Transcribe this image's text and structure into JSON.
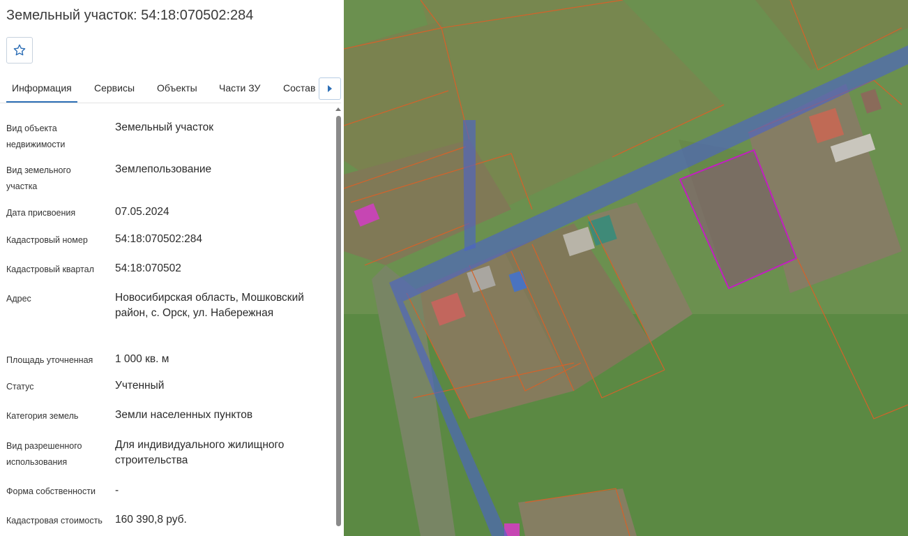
{
  "header": {
    "title": "Земельный участок: 54:18:070502:284"
  },
  "toolbar": {
    "favorite_icon": "star-icon"
  },
  "tabs": [
    {
      "label": "Информация",
      "active": true
    },
    {
      "label": "Сервисы",
      "active": false
    },
    {
      "label": "Объекты",
      "active": false
    },
    {
      "label": "Части ЗУ",
      "active": false
    },
    {
      "label": "Состав",
      "active": false
    }
  ],
  "tab_scroll_icon": "caret-right-icon",
  "info": {
    "rows": [
      {
        "label": "Вид объекта недвижимости",
        "value": "Земельный участок"
      },
      {
        "label": "Вид земельного участка",
        "value": "Землепользование"
      },
      {
        "label": "Дата присвоения",
        "value": "07.05.2024"
      },
      {
        "label": "Кадастровый номер",
        "value": "54:18:070502:284"
      },
      {
        "label": "Кадастровый квартал",
        "value": "54:18:070502"
      },
      {
        "label": "Адрес",
        "value": "Новосибирская область, Мошковский район, с. Орск, ул. Набережная"
      },
      {
        "label": "Площадь уточненная",
        "value": "1 000 кв. м"
      },
      {
        "label": "Статус",
        "value": "Учтенный"
      },
      {
        "label": "Категория земель",
        "value": "Земли населенных пунктов"
      },
      {
        "label": "Вид разрешенного использования",
        "value": "Для индивидуального жилищного строительства"
      },
      {
        "label": "Форма собственности",
        "value": "-"
      },
      {
        "label": "Кадастровая стоимость",
        "value": "160 390,8 руб."
      }
    ]
  },
  "colors": {
    "accent": "#2e6fb6",
    "selected_parcel": "#c21fc0",
    "parcel_border": "#d4622a",
    "road_overlay": "#4b63c9"
  }
}
